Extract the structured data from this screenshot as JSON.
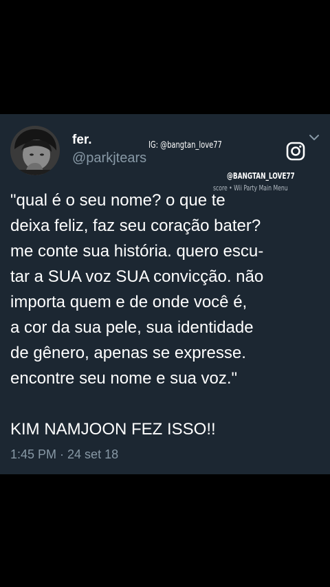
{
  "tweet": {
    "author_name": "fer.",
    "author_handle": "@parkjtears",
    "text_lines": [
      "\"qual é o seu nome? o que te",
      "deixa feliz, faz seu coração bater?",
      "me conte sua história. quero escu-",
      "tar a SUA voz SUA convicção. não",
      "importa quem e de onde você é,",
      "a cor da sua pele, sua identidade",
      "de gênero, apenas se expresse.",
      "encontre seu nome e sua voz.\""
    ],
    "closing_line": "KIM NAMJOON FEZ ISSO!!",
    "timestamp": "1:45 PM · 24 set 18"
  },
  "watermark": {
    "ig_text": "IG: @bangtan_love77",
    "handle": "@BANGTAN_LOVE77",
    "caption": "score • Wii Party Main Menu",
    "icon": "instagram-icon"
  },
  "icons": {
    "chevron": "chevron-down-icon",
    "avatar": "avatar"
  },
  "colors": {
    "page_background": "#000000",
    "card_background": "#1c2732",
    "text_primary": "#ffffff",
    "text_secondary": "#8899a6"
  }
}
